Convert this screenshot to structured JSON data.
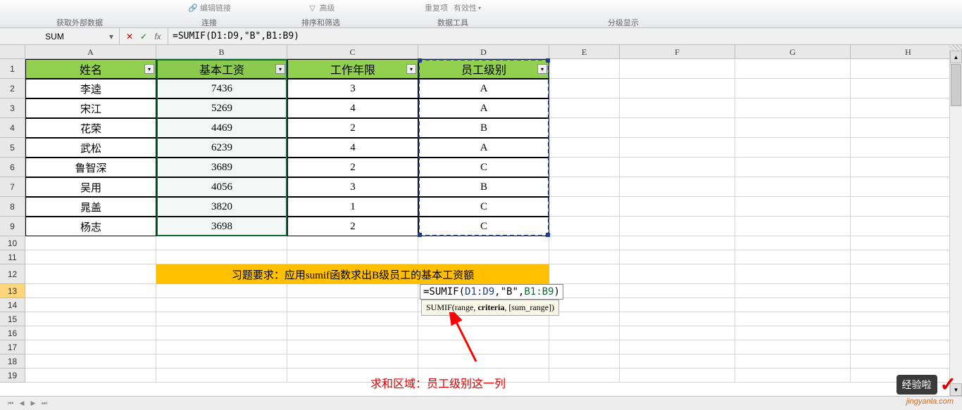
{
  "ribbon": {
    "groups": [
      {
        "label": "获取外部数据",
        "items": []
      },
      {
        "label": "连接",
        "items": [
          "编辑链接"
        ]
      },
      {
        "label": "排序和筛选",
        "items": [
          "高级"
        ]
      },
      {
        "label": "数据工具",
        "items": [
          "重复项",
          "有效性"
        ]
      },
      {
        "label": "分级显示",
        "items": []
      }
    ]
  },
  "name_box": "SUM",
  "formula_bar": "=SUMIF(D1:D9,\"B\",B1:B9)",
  "columns": [
    "A",
    "B",
    "C",
    "D",
    "E",
    "F",
    "G",
    "H"
  ],
  "headers": [
    "姓名",
    "基本工资",
    "工作年限",
    "员工级别"
  ],
  "table_rows": [
    [
      "李逵",
      "7436",
      "3",
      "A"
    ],
    [
      "宋江",
      "5269",
      "4",
      "A"
    ],
    [
      "花荣",
      "4469",
      "2",
      "B"
    ],
    [
      "武松",
      "6239",
      "4",
      "A"
    ],
    [
      "鲁智深",
      "3689",
      "2",
      "C"
    ],
    [
      "吴用",
      "4056",
      "3",
      "B"
    ],
    [
      "晁盖",
      "3820",
      "1",
      "C"
    ],
    [
      "杨志",
      "3698",
      "2",
      "C"
    ]
  ],
  "banner_text": "习题要求：应用sumif函数求出B级员工的基本工资额",
  "formula_overlay": {
    "prefix": "=SUMIF(",
    "arg1": "D1:D9",
    "sep1": ",",
    "arg2": "\"B\"",
    "sep2": ",",
    "arg3": "B1:B9",
    "suffix": ")"
  },
  "tooltip": {
    "fn": "SUMIF",
    "open": "(",
    "p1": "range",
    "s1": ", ",
    "p2": "criteria",
    "s2": ", ",
    "p3": "[sum_range]",
    "close": ")"
  },
  "annotation_text": "求和区域：员工级别这一列",
  "watermark": {
    "text": "经验啦",
    "url": "jingyanla.com"
  }
}
